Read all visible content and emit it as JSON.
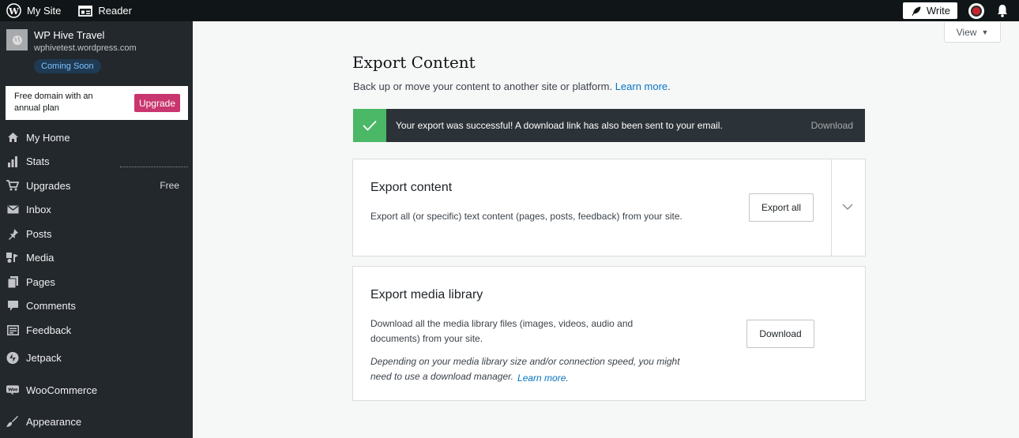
{
  "topbar": {
    "my_site": "My Site",
    "reader": "Reader",
    "write": "Write"
  },
  "site": {
    "name": "WP Hive Travel",
    "url": "wphivetest.wordpress.com",
    "status": "Coming Soon"
  },
  "upsell": {
    "text": "Free domain with an annual plan",
    "button": "Upgrade"
  },
  "menu": [
    {
      "label": "My Home",
      "icon": "home-icon"
    },
    {
      "label": "Stats",
      "icon": "stats-icon"
    },
    {
      "label": "Upgrades",
      "icon": "cart-icon",
      "badge": "Free"
    },
    {
      "label": "Inbox",
      "icon": "mail-icon"
    },
    {
      "label": "Posts",
      "icon": "pin-icon"
    },
    {
      "label": "Media",
      "icon": "media-icon"
    },
    {
      "label": "Pages",
      "icon": "pages-icon"
    },
    {
      "label": "Comments",
      "icon": "comment-icon"
    },
    {
      "label": "Feedback",
      "icon": "feedback-icon"
    },
    {
      "label": "Jetpack",
      "icon": "jetpack-icon"
    },
    {
      "label": "WooCommerce",
      "icon": "woocommerce-icon"
    },
    {
      "label": "Appearance",
      "icon": "brush-icon"
    }
  ],
  "main": {
    "view_label": "View",
    "title": "Export Content",
    "subtitle": "Back up or move your content to another site or platform.",
    "subtitle_link": "Learn more",
    "notice": {
      "text": "Your export was successful! A download link has also been sent to your email.",
      "action": "Download"
    },
    "export_card": {
      "title": "Export content",
      "description": "Export all (or specific) text content (pages, posts, feedback) from your site.",
      "button": "Export all"
    },
    "media_card": {
      "title": "Export media library",
      "description": "Download all the media library files (images, videos, audio and documents) from your site.",
      "note": "Depending on your media library size and/or connection speed, you might need to use a download manager.",
      "note_link": "Learn more",
      "button": "Download"
    }
  },
  "colors": {
    "sidebar_bg": "#23282d",
    "topbar_bg": "#101517",
    "success": "#4ab866",
    "notice_bg": "#2c3338",
    "upgrade": "#c9356e",
    "link": "#0675c4"
  }
}
